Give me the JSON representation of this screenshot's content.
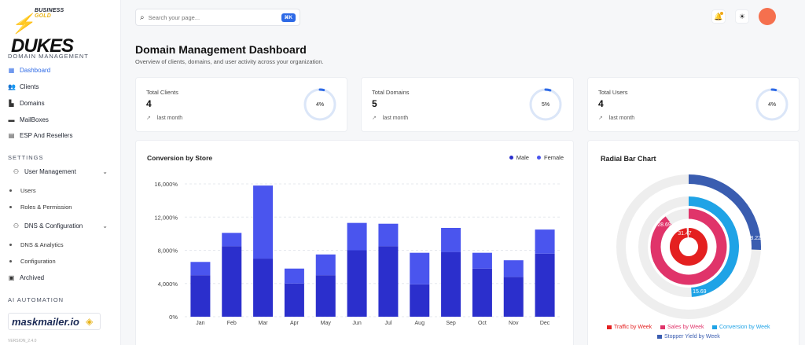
{
  "brand": {
    "top_left": "BUSINESS",
    "top_right": "GOLD",
    "name": "DUKES"
  },
  "sidebar": {
    "sections": {
      "domain": "DOMAIN MANAGEMENT",
      "settings": "SETTINGS",
      "ai": "AI AUTOMATION"
    },
    "items": {
      "dashboard": "Dashboard",
      "clients": "Clients",
      "domains": "Domains",
      "mailboxes": "MailBoxes",
      "esp": "ESP And Resellers",
      "user_mgmt": "User Management",
      "users": "Users",
      "roles": "Roles & Permission",
      "dns_config": "DNS & Configuration",
      "dns_analytics": "DNS & Analytics",
      "configuration": "Configuration",
      "archived": "Archived"
    },
    "partner_logo": "maskmailer.io",
    "version": "VERSION_2.4.0"
  },
  "search": {
    "placeholder": "Search your page...",
    "shortcut": "⌘K"
  },
  "header": {
    "title": "Domain Management Dashboard",
    "subtitle": "Overview of clients, domains, and user activity across your organization."
  },
  "stats": [
    {
      "label": "Total Clients",
      "value": "4",
      "trend": "last month",
      "percent_text": "4%",
      "percent": 4
    },
    {
      "label": "Total Domains",
      "value": "5",
      "trend": "last month",
      "percent_text": "5%",
      "percent": 5
    },
    {
      "label": "Total Users",
      "value": "4",
      "trend": "last month",
      "percent_text": "4%",
      "percent": 4
    }
  ],
  "colors": {
    "male": "#2b2fcc",
    "female": "#4a55ee",
    "accent": "#2e6ae6",
    "traffic": "#e42020",
    "sales": "#e0346a",
    "conversion": "#1fa3e6",
    "stopper": "#3a5db0",
    "track": "#eeeeee"
  },
  "chart_data": [
    {
      "type": "bar",
      "title": "Conversion by Store",
      "stacked": true,
      "categories": [
        "Jan",
        "Feb",
        "Mar",
        "Apr",
        "May",
        "Jun",
        "Jul",
        "Aug",
        "Sep",
        "Oct",
        "Nov",
        "Dec"
      ],
      "series": [
        {
          "name": "Male",
          "values": [
            5000,
            8500,
            7000,
            4000,
            5000,
            8000,
            8500,
            3900,
            7800,
            5800,
            4800,
            7600
          ]
        },
        {
          "name": "Female",
          "values": [
            1600,
            1600,
            8800,
            1800,
            2500,
            3300,
            2700,
            3800,
            2900,
            1900,
            2000,
            2900
          ]
        }
      ],
      "ylim": [
        0,
        16000
      ],
      "yticks": [
        "0%",
        "4,000%",
        "8,000%",
        "12,000%",
        "16,000%"
      ],
      "legend": "top-right",
      "grid": true
    },
    {
      "type": "radialBar",
      "title": "Radial Bar Chart",
      "series": [
        {
          "name": "Traffic by Week",
          "value": 31.47,
          "label": "31.47"
        },
        {
          "name": "Sales by Week",
          "value": 28.69,
          "label": "28.69"
        },
        {
          "name": "Conversion by Week",
          "value": 15.69,
          "label": "15.69"
        },
        {
          "name": "Stopper Yield by Week",
          "value": 8.22,
          "label": "8.22"
        }
      ],
      "legend": "bottom"
    }
  ]
}
